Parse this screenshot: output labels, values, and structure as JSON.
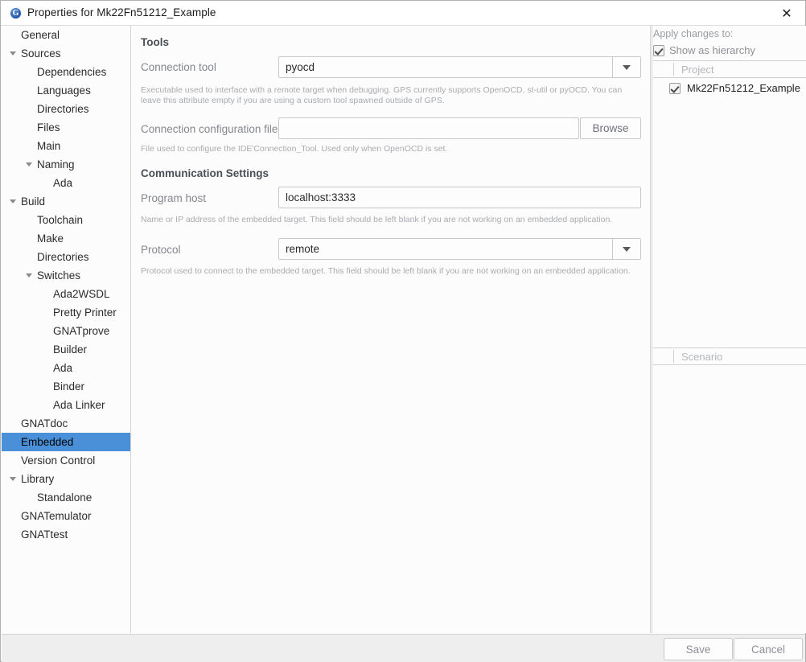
{
  "window": {
    "title": "Properties for Mk22Fn51212_Example",
    "icon": "gnat-studio-icon",
    "close_label": "✕"
  },
  "sidebar": {
    "items": [
      {
        "label": "General",
        "indent": 0,
        "expander": "none",
        "selected": false
      },
      {
        "label": "Sources",
        "indent": 0,
        "expander": "expanded",
        "selected": false
      },
      {
        "label": "Dependencies",
        "indent": 1,
        "expander": "none",
        "selected": false
      },
      {
        "label": "Languages",
        "indent": 1,
        "expander": "none",
        "selected": false
      },
      {
        "label": "Directories",
        "indent": 1,
        "expander": "none",
        "selected": false
      },
      {
        "label": "Files",
        "indent": 1,
        "expander": "none",
        "selected": false
      },
      {
        "label": "Main",
        "indent": 1,
        "expander": "none",
        "selected": false
      },
      {
        "label": "Naming",
        "indent": 1,
        "expander": "expanded",
        "selected": false
      },
      {
        "label": "Ada",
        "indent": 2,
        "expander": "none",
        "selected": false
      },
      {
        "label": "Build",
        "indent": 0,
        "expander": "expanded",
        "selected": false
      },
      {
        "label": "Toolchain",
        "indent": 1,
        "expander": "none",
        "selected": false
      },
      {
        "label": "Make",
        "indent": 1,
        "expander": "none",
        "selected": false
      },
      {
        "label": "Directories",
        "indent": 1,
        "expander": "none",
        "selected": false
      },
      {
        "label": "Switches",
        "indent": 1,
        "expander": "expanded",
        "selected": false
      },
      {
        "label": "Ada2WSDL",
        "indent": 2,
        "expander": "none",
        "selected": false
      },
      {
        "label": "Pretty Printer",
        "indent": 2,
        "expander": "none",
        "selected": false
      },
      {
        "label": "GNATprove",
        "indent": 2,
        "expander": "none",
        "selected": false
      },
      {
        "label": "Builder",
        "indent": 2,
        "expander": "none",
        "selected": false
      },
      {
        "label": "Ada",
        "indent": 2,
        "expander": "none",
        "selected": false
      },
      {
        "label": "Binder",
        "indent": 2,
        "expander": "none",
        "selected": false
      },
      {
        "label": "Ada Linker",
        "indent": 2,
        "expander": "none",
        "selected": false
      },
      {
        "label": "GNATdoc",
        "indent": 0,
        "expander": "none",
        "selected": false
      },
      {
        "label": "Embedded",
        "indent": 0,
        "expander": "none",
        "selected": true
      },
      {
        "label": "Version Control",
        "indent": 0,
        "expander": "none",
        "selected": false
      },
      {
        "label": "Library",
        "indent": 0,
        "expander": "expanded",
        "selected": false
      },
      {
        "label": "Standalone",
        "indent": 1,
        "expander": "none",
        "selected": false
      },
      {
        "label": "GNATemulator",
        "indent": 0,
        "expander": "none",
        "selected": false
      },
      {
        "label": "GNATtest",
        "indent": 0,
        "expander": "none",
        "selected": false
      }
    ]
  },
  "main": {
    "tools_section_title": "Tools",
    "connection_tool": {
      "label": "Connection tool",
      "value": "pyocd",
      "help": "Executable used to interface with a remote target when debugging. GPS currently supports OpenOCD, st-util or pyOCD. You can leave this attribute empty if you are using a custom tool spawned outside of GPS."
    },
    "connection_config_file": {
      "label": "Connection configuration file",
      "value": "",
      "placeholder": "",
      "browse_label": "Browse",
      "help": "File used to configure the IDE'Connection_Tool. Used only when OpenOCD is set."
    },
    "comm_section_title": "Communication Settings",
    "program_host": {
      "label": "Program host",
      "value": "localhost:3333",
      "help": "Name or IP address of the embedded target. This field should be left blank if you are not working on an embedded application."
    },
    "protocol": {
      "label": "Protocol",
      "value": "remote",
      "help": "Protocol used to connect to the embedded target. This field should be left blank if you are not working on an embedded application."
    }
  },
  "right_panel": {
    "apply_changes_label": "Apply changes to:",
    "show_as_hierarchy": {
      "label": "Show as hierarchy",
      "checked": true
    },
    "project_column_header": "Project",
    "projects": [
      {
        "name": "Mk22Fn51212_Example",
        "checked": true
      }
    ],
    "scenario_column_header": "Scenario",
    "scenarios": []
  },
  "footer": {
    "save_label": "Save",
    "cancel_label": "Cancel"
  },
  "colors": {
    "selection": "#4a90d9",
    "footer_bg": "#eeeeee",
    "help_text": "#a8abaf",
    "label_text": "#84878c"
  }
}
